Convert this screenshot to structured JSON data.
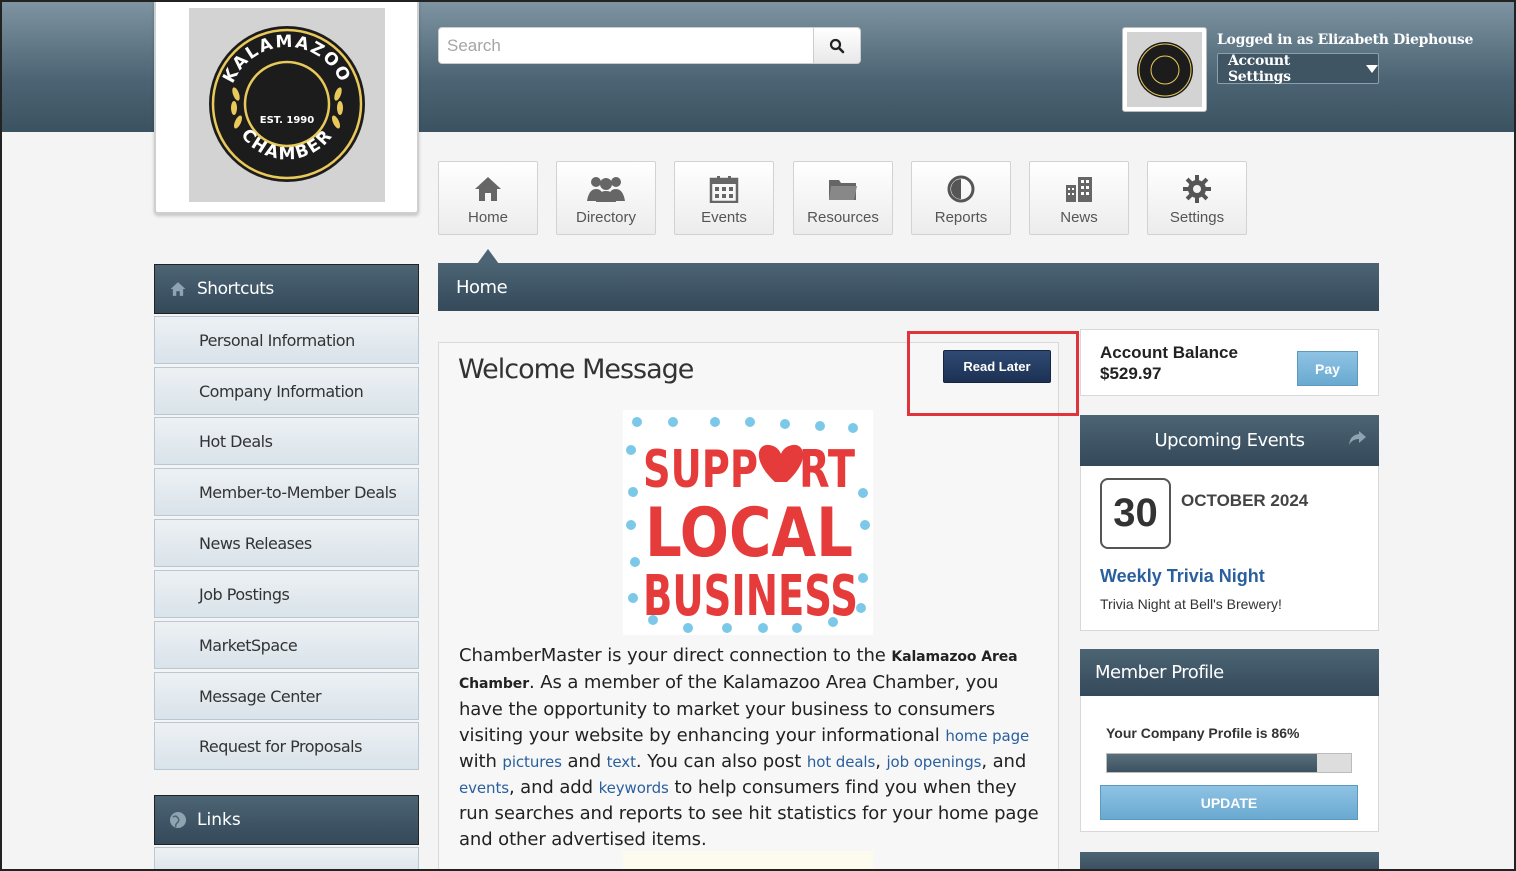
{
  "header": {
    "search_placeholder": "Search",
    "logged_in_text": "Logged in as Elizabeth Diephouse",
    "account_settings_label": "Account Settings"
  },
  "logo": {
    "top_text": "KALAMAZOO",
    "bottom_text": "CHAMBER",
    "est_text": "EST. 1990"
  },
  "nav": {
    "items": [
      {
        "label": "Home",
        "icon": "home-icon"
      },
      {
        "label": "Directory",
        "icon": "people-icon"
      },
      {
        "label": "Events",
        "icon": "calendar-icon"
      },
      {
        "label": "Resources",
        "icon": "folder-icon"
      },
      {
        "label": "Reports",
        "icon": "pie-chart-icon"
      },
      {
        "label": "News",
        "icon": "buildings-icon"
      },
      {
        "label": "Settings",
        "icon": "gear-icon"
      }
    ]
  },
  "sidebar": {
    "shortcuts_title": "Shortcuts",
    "items": [
      {
        "label": "Personal Information"
      },
      {
        "label": "Company Information"
      },
      {
        "label": "Hot Deals"
      },
      {
        "label": "Member-to-Member Deals"
      },
      {
        "label": "News Releases"
      },
      {
        "label": "Job Postings"
      },
      {
        "label": "MarketSpace"
      },
      {
        "label": "Message Center"
      },
      {
        "label": "Request for Proposals"
      }
    ],
    "links_title": "Links"
  },
  "main": {
    "section_title": "Home",
    "welcome_title": "Welcome Message",
    "read_later_label": "Read Later",
    "banner": {
      "line1": "SUPP",
      "line1b": "RT",
      "line2": "LOCAL",
      "line3": "BUSINESS"
    },
    "text": {
      "p1": "ChamberMaster is your direct connection to the ",
      "org": "Kalamazoo Area Chamber",
      "p2": ". As a member of the Kalamazoo Area Chamber, you have the opportunity to market your business to consumers visiting your website by enhancing your informational ",
      "l_home_page": "home page",
      "p3": " with ",
      "l_pictures": "pictures",
      "p4": " and ",
      "l_text": "text",
      "p5": ". You can also post ",
      "l_hot_deals": "hot deals",
      "p6": ", ",
      "l_job_openings": "job openings",
      "p7": ", and ",
      "l_events": "events",
      "p8": ", and add ",
      "l_keywords": "keywords",
      "p9": " to help consumers find you when they run searches and reports to see hit statistics for your home page and other advertised items."
    }
  },
  "account": {
    "balance_label": "Account Balance",
    "balance_value": "$529.97",
    "pay_label": "Pay"
  },
  "events": {
    "title": "Upcoming Events",
    "day": "30",
    "month_year": "OCTOBER 2024",
    "event_title": "Weekly Trivia Night",
    "event_desc": "Trivia Night at Bell's Brewery!"
  },
  "member_profile": {
    "title": "Member Profile",
    "profile_text": "Your Company Profile is 86%",
    "percent": 86,
    "update_label": "UPDATE"
  },
  "colors": {
    "header_dark": "#3b5261",
    "accent_blue": "#2a5f9e",
    "button_navy": "#1c3154",
    "button_light": "#6aa9d0",
    "highlight_red": "#e0343d",
    "banner_red": "#e63b3b",
    "banner_dots": "#7cc8e8"
  }
}
